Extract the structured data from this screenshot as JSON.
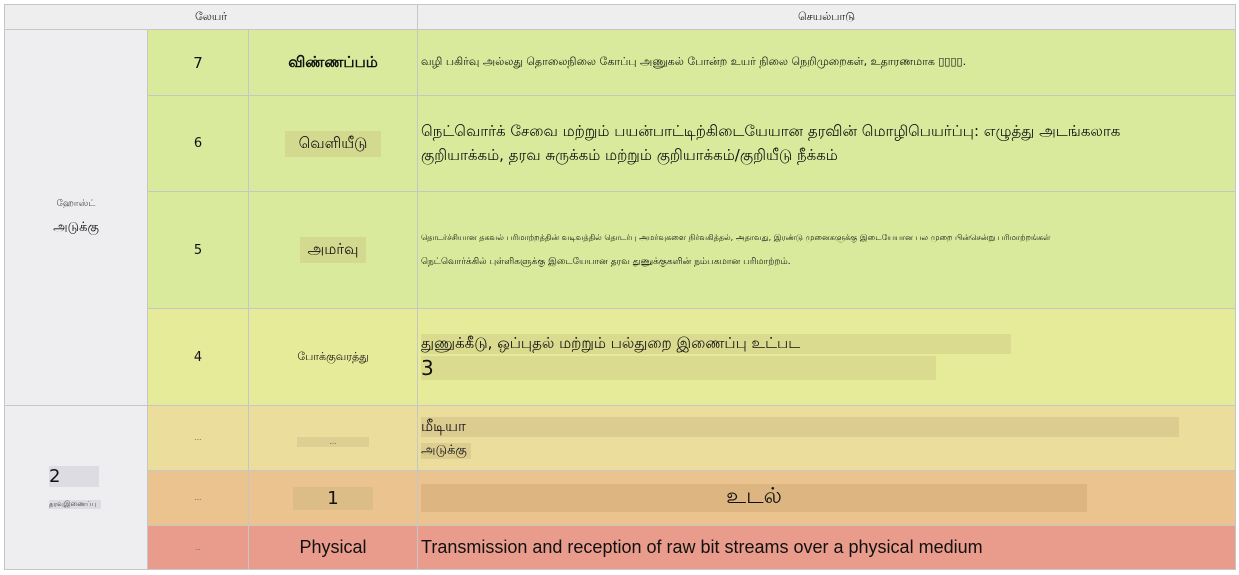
{
  "header": {
    "layer": "லேயர்",
    "function": "செயல்பாடு"
  },
  "host_stack": {
    "line1": "ஹோஸ்ட்",
    "line2": "அடுக்கு"
  },
  "media_stack": {
    "number": "2",
    "label": "தரவுஇணைப்பு"
  },
  "rows": [
    {
      "num": "7",
      "name": "விண்ணப்பம்",
      "desc": "வழி பகிர்வு அல்லது தொலைநிலை கோப்பு அணுகல் போன்ற உயர் நிலை நெறிமுறைகள், உதாரணமாக ▯▯▯▯."
    },
    {
      "num": "6",
      "name": "வெளியீடு",
      "desc_l1": "நெட்வொர்க் சேவை மற்றும் பயன்பாட்டிற்கிடையேயான தரவின் மொழிபெயர்ப்பு: எழுத்து அடங்கலாக",
      "desc_l2": "குறியாக்கம், தரவ சுருக்கம் மற்றும் குறியாக்கம்/குறியீடு நீக்கம்"
    },
    {
      "num": "5",
      "name": "அமர்வு",
      "desc_l1": "தொடர்ச்சியான தகவல் பரிமாற்றத்தின் வடிவத்தில் தொடர்பு அமர்வுகளை நிர்வகித்தல், அதாவது, இரண்டு முனைகளுக்கு இடையேயான பல முறை பின்சென்று பரிமாற்றங்கள்",
      "desc_l2": "நெட்வொர்க்கில் புள்ளிகளுக்கு இடையேயான தரவ துணுக்குகளின் நம்பகமான பரிமாற்றம்."
    },
    {
      "num": "4",
      "name": "போக்குவரத்து",
      "desc_l1": "துணுக்கீடு, ஒப்புதல் மற்றும் பல்துறை இணைப்பு உட்பட",
      "desc_l2": "3"
    },
    {
      "num": "...",
      "name": "...",
      "desc_l1": "மீடியா",
      "desc_l2": "அடுக்கு"
    },
    {
      "num": "...",
      "name": "1",
      "desc": "உடல்"
    },
    {
      "num": "..",
      "name": "Physical",
      "desc": "Transmission and reception of raw bit streams over a physical medium"
    }
  ]
}
